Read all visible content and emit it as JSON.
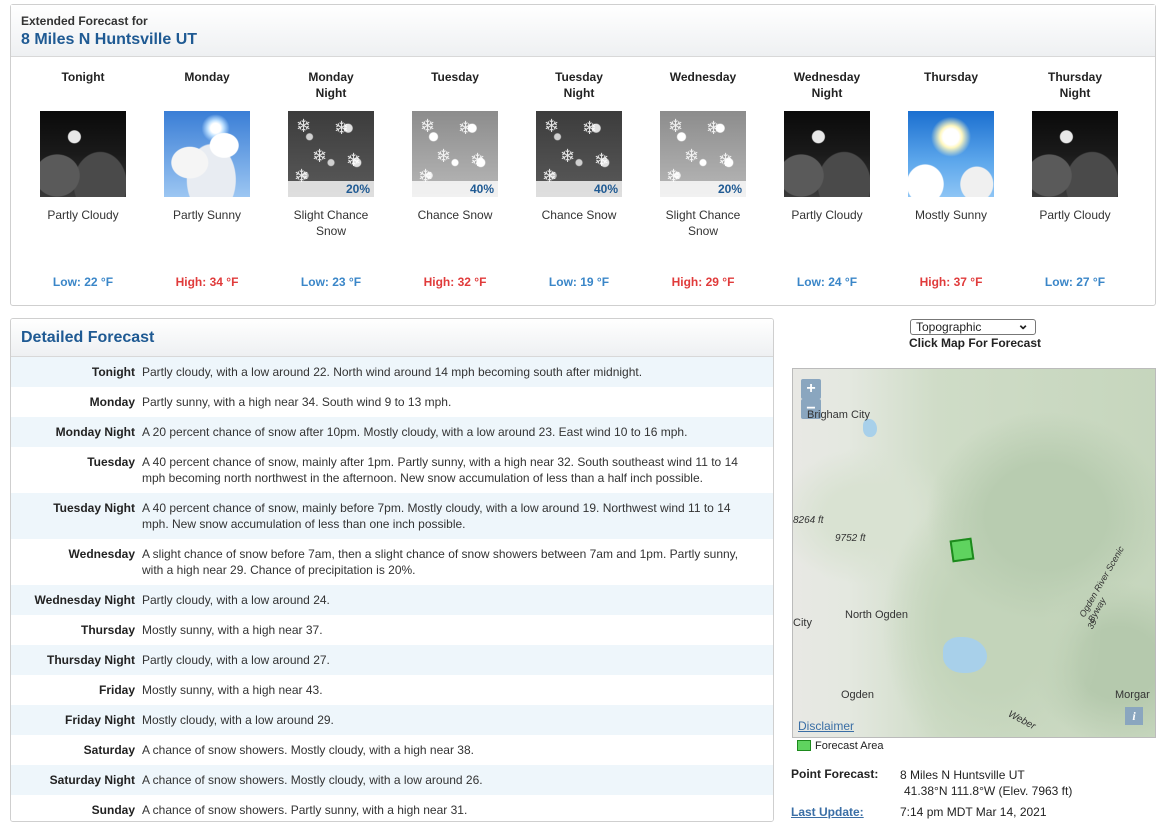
{
  "extended": {
    "label": "Extended Forecast for",
    "location": "8 Miles N Huntsville UT",
    "periods": [
      {
        "name_line1": "Tonight",
        "name_line2": "",
        "icon": "night-partly-cloudy-icon",
        "pop": "",
        "desc_line1": "Partly Cloudy",
        "desc_line2": "",
        "temp": "Low: 22 °F",
        "kind": "low"
      },
      {
        "name_line1": "Monday",
        "name_line2": "",
        "icon": "partly-sunny-icon",
        "pop": "",
        "desc_line1": "Partly Sunny",
        "desc_line2": "",
        "temp": "High: 34 °F",
        "kind": "high"
      },
      {
        "name_line1": "Monday",
        "name_line2": "Night",
        "icon": "snow-night-icon",
        "pop": "20%",
        "desc_line1": "Slight Chance",
        "desc_line2": "Snow",
        "temp": "Low: 23 °F",
        "kind": "low"
      },
      {
        "name_line1": "Tuesday",
        "name_line2": "",
        "icon": "snow-day-icon",
        "pop": "40%",
        "desc_line1": "Chance Snow",
        "desc_line2": "",
        "temp": "High: 32 °F",
        "kind": "high"
      },
      {
        "name_line1": "Tuesday",
        "name_line2": "Night",
        "icon": "snow-night-icon",
        "pop": "40%",
        "desc_line1": "Chance Snow",
        "desc_line2": "",
        "temp": "Low: 19 °F",
        "kind": "low"
      },
      {
        "name_line1": "Wednesday",
        "name_line2": "",
        "icon": "snow-day-icon",
        "pop": "20%",
        "desc_line1": "Slight Chance",
        "desc_line2": "Snow",
        "temp": "High: 29 °F",
        "kind": "high"
      },
      {
        "name_line1": "Wednesday",
        "name_line2": "Night",
        "icon": "night-partly-cloudy-icon",
        "pop": "",
        "desc_line1": "Partly Cloudy",
        "desc_line2": "",
        "temp": "Low: 24 °F",
        "kind": "low"
      },
      {
        "name_line1": "Thursday",
        "name_line2": "",
        "icon": "mostly-sunny-icon",
        "pop": "",
        "desc_line1": "Mostly Sunny",
        "desc_line2": "",
        "temp": "High: 37 °F",
        "kind": "high"
      },
      {
        "name_line1": "Thursday",
        "name_line2": "Night",
        "icon": "night-partly-cloudy-icon",
        "pop": "",
        "desc_line1": "Partly Cloudy",
        "desc_line2": "",
        "temp": "Low: 27 °F",
        "kind": "low"
      }
    ]
  },
  "detailed": {
    "title": "Detailed Forecast",
    "rows": [
      {
        "name": "Tonight",
        "text": "Partly cloudy, with a low around 22. North wind around 14 mph becoming south after midnight."
      },
      {
        "name": "Monday",
        "text": "Partly sunny, with a high near 34. South wind 9 to 13 mph."
      },
      {
        "name": "Monday Night",
        "text": "A 20 percent chance of snow after 10pm. Mostly cloudy, with a low around 23. East wind 10 to 16 mph."
      },
      {
        "name": "Tuesday",
        "text": "A 40 percent chance of snow, mainly after 1pm. Partly sunny, with a high near 32. South southeast wind 11 to 14 mph becoming north northwest in the afternoon. New snow accumulation of less than a half inch possible."
      },
      {
        "name": "Tuesday Night",
        "text": "A 40 percent chance of snow, mainly before 7pm. Mostly cloudy, with a low around 19. Northwest wind 11 to 14 mph. New snow accumulation of less than one inch possible."
      },
      {
        "name": "Wednesday",
        "text": "A slight chance of snow before 7am, then a slight chance of snow showers between 7am and 1pm. Partly sunny, with a high near 29. Chance of precipitation is 20%."
      },
      {
        "name": "Wednesday Night",
        "text": "Partly cloudy, with a low around 24."
      },
      {
        "name": "Thursday",
        "text": "Mostly sunny, with a high near 37."
      },
      {
        "name": "Thursday Night",
        "text": "Partly cloudy, with a low around 27."
      },
      {
        "name": "Friday",
        "text": "Mostly sunny, with a high near 43."
      },
      {
        "name": "Friday Night",
        "text": "Mostly cloudy, with a low around 29."
      },
      {
        "name": "Saturday",
        "text": "A chance of snow showers. Mostly cloudy, with a high near 38."
      },
      {
        "name": "Saturday Night",
        "text": "A chance of snow showers. Mostly cloudy, with a low around 26."
      },
      {
        "name": "Sunday",
        "text": "A chance of snow showers. Partly sunny, with a high near 31."
      }
    ]
  },
  "map": {
    "select_value": "Topographic",
    "hint": "Click Map For Forecast",
    "zoom_in": "+",
    "zoom_out": "−",
    "labels": {
      "brigham": "Brigham City",
      "elev1": "8264 ft",
      "elev2": "9752 ft",
      "north_ogden": "North Ogden",
      "city": "City",
      "ogden": "Ogden",
      "morgan": "Morgar",
      "weber": "Weber",
      "ogden_river": "Ogden River Scenic Byway",
      "route": "39"
    },
    "disclaimer": "Disclaimer",
    "info": "i",
    "legend": "Forecast Area"
  },
  "point": {
    "label": "Point Forecast:",
    "location": "8 Miles N Huntsville UT",
    "coords": "41.38°N 111.8°W (Elev. 7963 ft)",
    "update_label": "Last Update:",
    "update_value": "7:14 pm MDT Mar 14, 2021"
  },
  "colors": {
    "title_blue": "#1f5a93",
    "low_temp": "#3a86c8",
    "high_temp": "#e03b3b",
    "row_tint": "#eef6fb",
    "forecast_area": "#5fd35f"
  }
}
